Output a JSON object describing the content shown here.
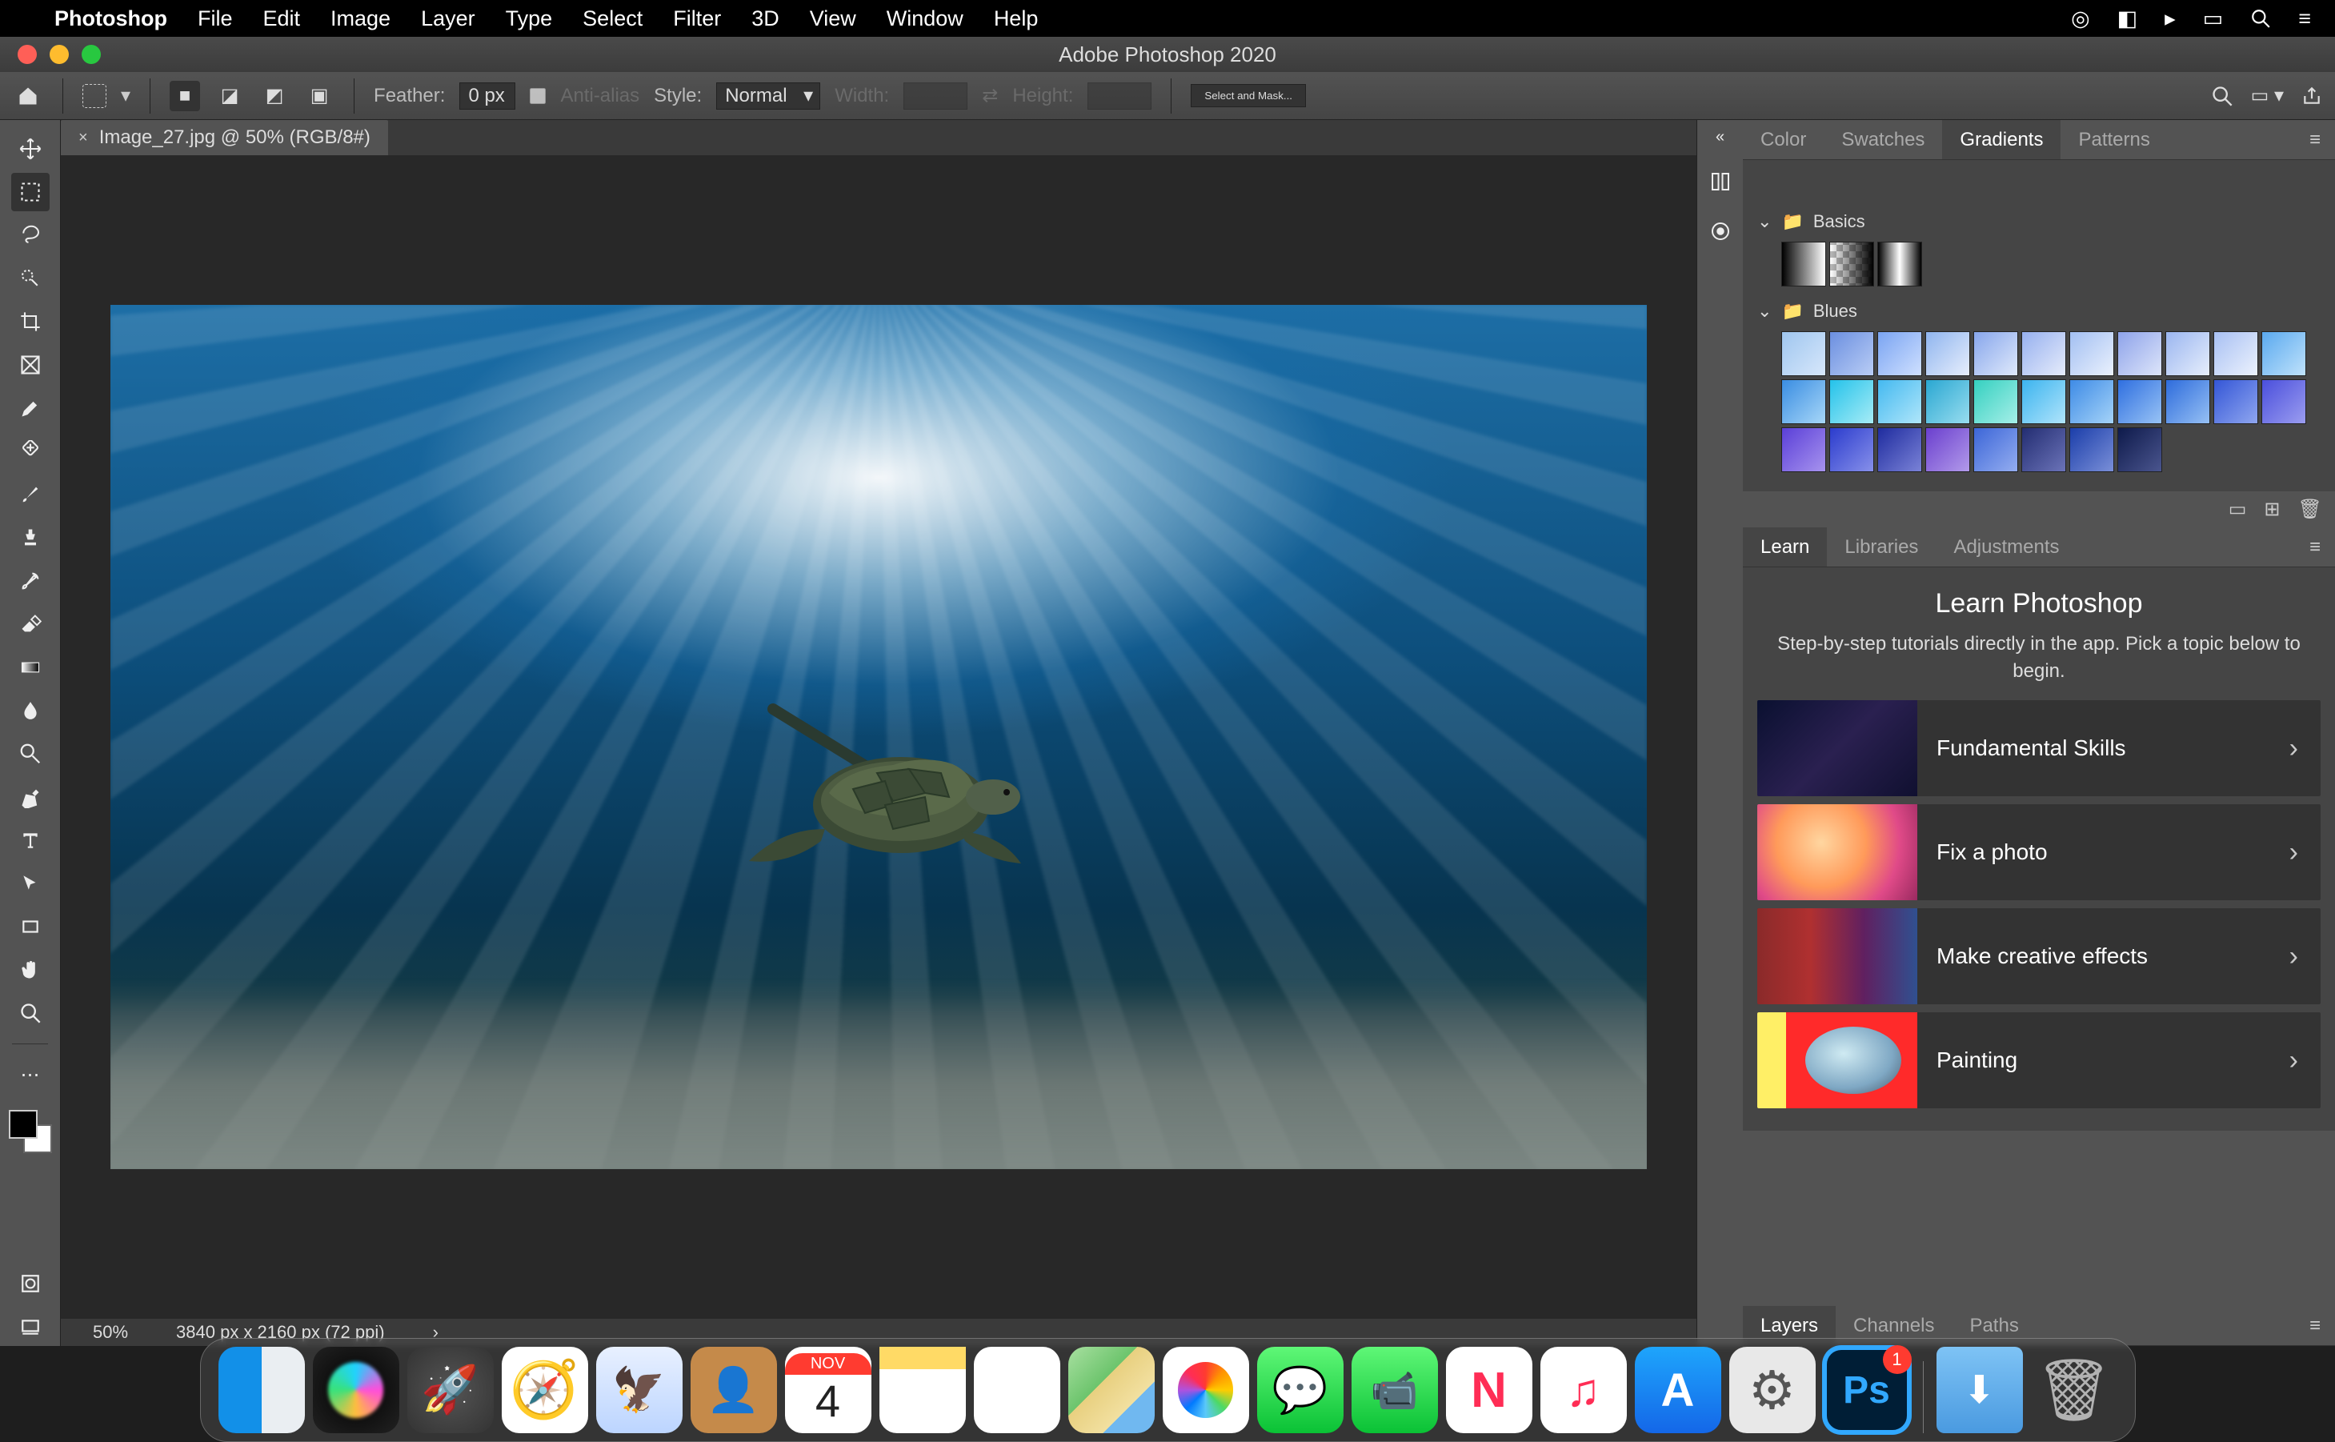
{
  "macos": {
    "app_name": "Photoshop",
    "menus": [
      "File",
      "Edit",
      "Image",
      "Layer",
      "Type",
      "Select",
      "Filter",
      "3D",
      "View",
      "Window",
      "Help"
    ]
  },
  "window": {
    "title": "Adobe Photoshop 2020"
  },
  "options": {
    "feather_label": "Feather:",
    "feather_value": "0 px",
    "antialias_label": "Anti-alias",
    "style_label": "Style:",
    "style_value": "Normal",
    "width_label": "Width:",
    "height_label": "Height:",
    "select_mask": "Select and Mask..."
  },
  "document": {
    "tab_title": "Image_27.jpg @ 50% (RGB/8#)",
    "zoom": "50%",
    "dimensions": "3840 px x 2160 px (72 ppi)"
  },
  "tools": [
    "move-tool",
    "marquee-tool",
    "lasso-tool",
    "quick-select-tool",
    "crop-tool",
    "frame-tool",
    "eyedropper-tool",
    "healing-brush-tool",
    "brush-tool",
    "clone-stamp-tool",
    "history-brush-tool",
    "eraser-tool",
    "gradient-tool",
    "blur-tool",
    "dodge-tool",
    "pen-tool",
    "type-tool",
    "path-select-tool",
    "rectangle-tool",
    "hand-tool",
    "zoom-tool"
  ],
  "panels": {
    "row1": {
      "tabs": [
        "Color",
        "Swatches",
        "Gradients",
        "Patterns"
      ],
      "active": "Gradients",
      "gradients": {
        "groups": [
          {
            "name": "Basics",
            "swatches": [
              "linear-gradient(90deg,#000,#fff)",
              "linear-gradient(90deg,transparent,#000),repeating-conic-gradient(#bbb 0 25%,#fff 0 50%) 0/16px 16px",
              "linear-gradient(90deg,#000,#fff,#000)"
            ]
          },
          {
            "name": "Blues",
            "swatches": [
              "linear-gradient(135deg,#9fc6ef,#d7e7fb)",
              "linear-gradient(135deg,#6b8fe0,#b9cdf5)",
              "linear-gradient(135deg,#7aa4f2,#cfe0ff)",
              "linear-gradient(135deg,#8fb5ef,#e7eefc)",
              "linear-gradient(135deg,#87a6ec,#dfe9fb)",
              "linear-gradient(135deg,#96b0ef,#e6ecfb)",
              "linear-gradient(135deg,#a2bff2,#eaf1fd)",
              "linear-gradient(135deg,#8ea3ea,#dde5fa)",
              "linear-gradient(135deg,#9bb6f0,#e6eefc)",
              "linear-gradient(135deg,#a8c0f3,#ecf2fd)",
              "linear-gradient(135deg,#5aa9ef,#bfe2fb)",
              "linear-gradient(135deg,#3a8de2,#a7d7f8)",
              "linear-gradient(135deg,#24c2ea,#a7ecf6)",
              "linear-gradient(135deg,#44b9f0,#b0e6fa)",
              "linear-gradient(135deg,#2aa7d2,#98ddef)",
              "linear-gradient(135deg,#35d0c0,#a6efe8)",
              "linear-gradient(135deg,#3cb4ef,#b0e4fb)",
              "linear-gradient(135deg,#3e8be6,#a5d3f8)",
              "linear-gradient(135deg,#2f6fe0,#98c3f5)",
              "linear-gradient(135deg,#2e6cdc,#96c0f4)",
              "linear-gradient(135deg,#3456d7,#8fa6ef)",
              "linear-gradient(135deg,#4a4fdc,#9b9df0)",
              "linear-gradient(135deg,#5a3fd8,#a793ee)",
              "linear-gradient(135deg,#2b3ccd,#8790ea)",
              "linear-gradient(135deg,#1f2c9f,#7a82d7)",
              "linear-gradient(135deg,#6a3fce,#b29aea)",
              "linear-gradient(135deg,#3c66d8,#94adf0)",
              "linear-gradient(135deg,#232d72,#6b73b8)",
              "linear-gradient(135deg,#1b3eaa,#7a8fd8)",
              "linear-gradient(135deg,#0e1a4b,#4a558e)"
            ]
          }
        ]
      }
    },
    "row2": {
      "tabs": [
        "Learn",
        "Libraries",
        "Adjustments"
      ],
      "active": "Learn",
      "learn": {
        "title": "Learn Photoshop",
        "subtitle": "Step-by-step tutorials directly in the app. Pick a topic below to begin.",
        "items": [
          "Fundamental Skills",
          "Fix a photo",
          "Make creative effects",
          "Painting"
        ]
      }
    },
    "row3": {
      "tabs": [
        "Layers",
        "Channels",
        "Paths"
      ],
      "active": "Layers"
    }
  },
  "dock": {
    "apps": [
      "finder",
      "siri",
      "launchpad",
      "safari",
      "mail",
      "contacts",
      "calendar",
      "notes",
      "reminders",
      "maps",
      "photos",
      "messages",
      "facetime",
      "news",
      "music",
      "app-store",
      "system-preferences",
      "photoshop"
    ],
    "calendar": {
      "month": "NOV",
      "day": "4"
    },
    "photoshop_badge": "1",
    "extras": [
      "downloads",
      "trash"
    ]
  }
}
